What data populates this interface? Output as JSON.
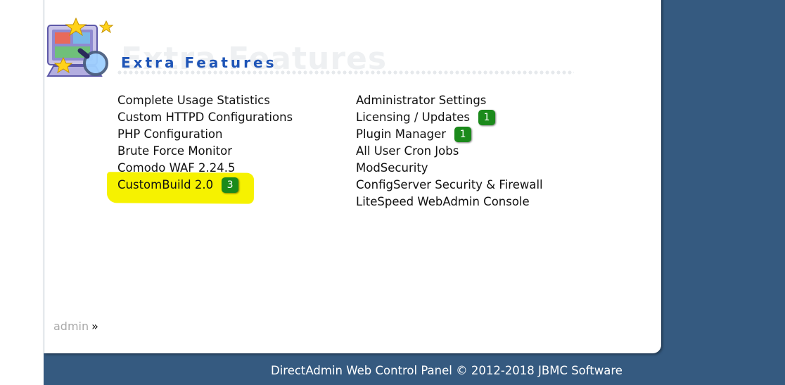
{
  "section": {
    "title": "Extra Features"
  },
  "links_left": [
    {
      "label": "Complete Usage Statistics"
    },
    {
      "label": "Custom HTTPD Configurations"
    },
    {
      "label": "PHP Configuration"
    },
    {
      "label": "Brute Force Monitor"
    },
    {
      "label": "Comodo WAF 2.24.5"
    },
    {
      "label": "CustomBuild 2.0",
      "badge": "3",
      "highlighted": true
    }
  ],
  "links_right": [
    {
      "label": "Administrator Settings"
    },
    {
      "label": "Licensing / Updates",
      "badge": "1"
    },
    {
      "label": "Plugin Manager",
      "badge": "1"
    },
    {
      "label": "All User Cron Jobs"
    },
    {
      "label": "ModSecurity"
    },
    {
      "label": "ConfigServer Security & Firewall"
    },
    {
      "label": "LiteSpeed WebAdmin Console"
    }
  ],
  "breadcrumb": {
    "root": "admin",
    "separator": "»"
  },
  "footer": {
    "text": "DirectAdmin Web Control Panel © 2012-2018 JBMC Software"
  },
  "colors": {
    "background": "#355a80",
    "title": "#1f55b7",
    "badge": "#1b8a1b",
    "highlight": "#f6f200",
    "breadcrumb_link": "#a9a9a9"
  },
  "icons": {
    "section_logo": "monitor-with-stars-and-magnifier-icon"
  }
}
